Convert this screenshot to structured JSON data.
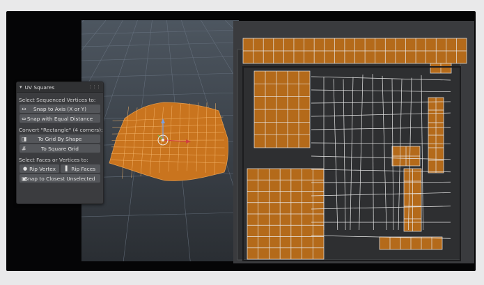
{
  "panel": {
    "title": "UV Squares",
    "icons": {
      "collapse": "chevron-down-icon",
      "grip": "drag-handle-icon"
    },
    "section1_label": "Select Sequenced Vertices to:",
    "snap_axis_label": "Snap to Axis (X or Y)",
    "snap_axis_icon": "↔",
    "snap_equal_label": "Snap with Equal Distance",
    "snap_equal_icon": "⇔",
    "section2_label": "Convert \"Rectangle\" (4 corners):",
    "grid_shape_label": "To Grid By Shape",
    "grid_shape_icon": "◨",
    "square_grid_label": "To Square Grid",
    "square_grid_icon": "#",
    "section3_label": "Select Faces or Vertices to:",
    "rip_vertex_label": "Rip Vertex",
    "rip_vertex_icon": "●",
    "rip_faces_label": "Rip Faces",
    "rip_faces_icon": "▌",
    "snap_closest_label": "Snap to Closest Unselected",
    "snap_closest_icon": "▣"
  },
  "colors": {
    "uv_selected": "#b46a1a",
    "uv_edge": "#e8e8e8",
    "mesh_face": "#c9741e",
    "background": "#050506",
    "uv_bg": "#3a3b3e"
  }
}
